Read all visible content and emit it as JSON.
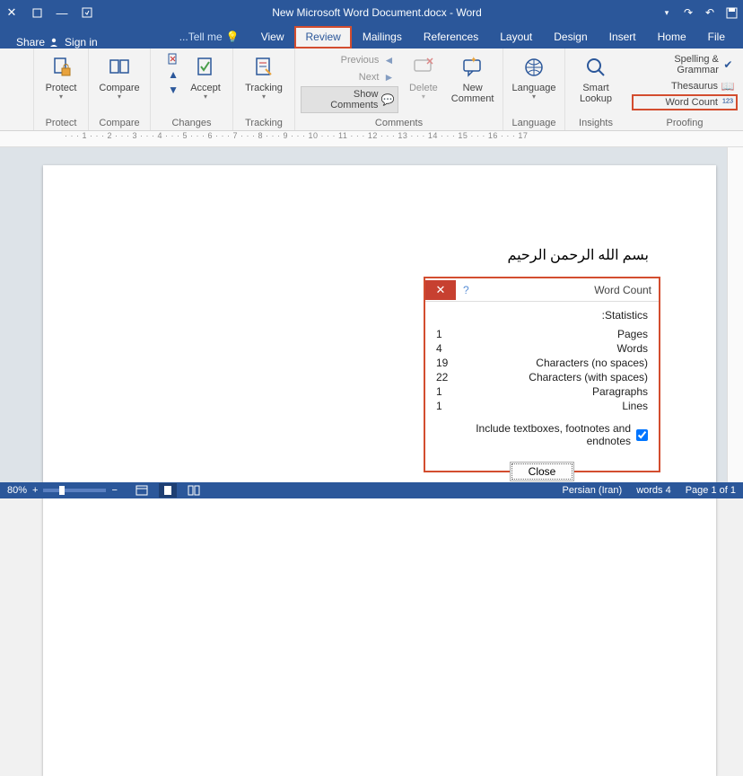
{
  "title": "New Microsoft Word Document.docx - Word",
  "tabs": {
    "file": "File",
    "home": "Home",
    "insert": "Insert",
    "design": "Design",
    "layout": "Layout",
    "references": "References",
    "mailings": "Mailings",
    "review": "Review",
    "view": "View",
    "tellme": "Tell me...",
    "signin": "Sign in",
    "share": "Share"
  },
  "ribbon": {
    "proofing": {
      "title": "Proofing",
      "spelling": "Spelling & Grammar",
      "thesaurus": "Thesaurus",
      "wordcount": "Word Count"
    },
    "insights": {
      "title": "Insights",
      "smart": "Smart Lookup"
    },
    "language": {
      "title": "Language",
      "language": "Language"
    },
    "comments": {
      "title": "Comments",
      "new": "New Comment",
      "delete": "Delete",
      "previous": "Previous",
      "next": "Next",
      "show": "Show Comments"
    },
    "tracking": {
      "title": "Tracking",
      "tracking": "Tracking"
    },
    "changes": {
      "title": "Changes",
      "accept": "Accept"
    },
    "compare": {
      "title": "Compare",
      "compare": "Compare"
    },
    "protect": {
      "title": "Protect",
      "protect": "Protect"
    }
  },
  "document_text": "بسم الله الرحمن الرحيم",
  "dialog": {
    "title": "Word Count",
    "statistics": "Statistics:",
    "rows": [
      {
        "k": "Pages",
        "v": "1"
      },
      {
        "k": "Words",
        "v": "4"
      },
      {
        "k": "Characters (no spaces)",
        "v": "19"
      },
      {
        "k": "Characters (with spaces)",
        "v": "22"
      },
      {
        "k": "Paragraphs",
        "v": "1"
      },
      {
        "k": "Lines",
        "v": "1"
      }
    ],
    "include": "Include textboxes, footnotes and endnotes",
    "close": "Close"
  },
  "status": {
    "page": "Page 1 of 1",
    "words": "4 words",
    "lang": "Persian (Iran)",
    "zoom": "80%"
  }
}
